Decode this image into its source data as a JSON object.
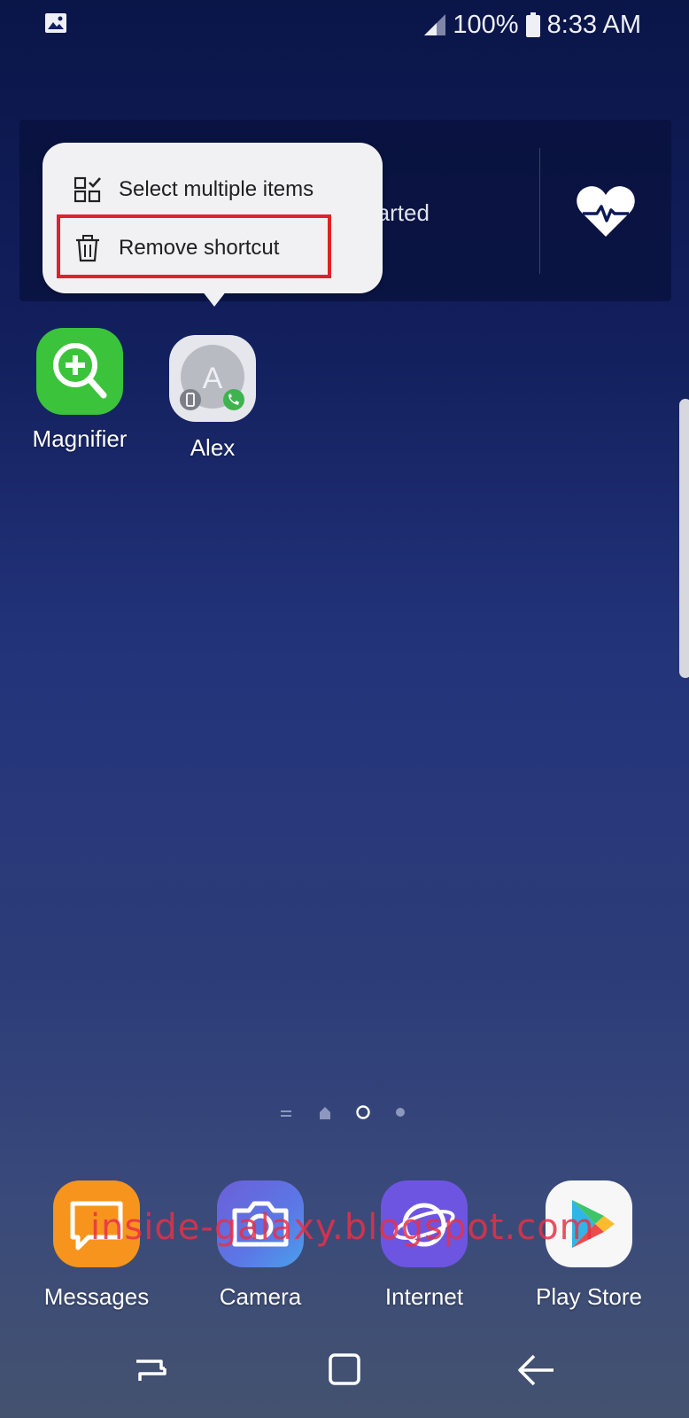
{
  "status_bar": {
    "battery": "100%",
    "time": "8:33 AM",
    "icons": [
      "gallery-icon",
      "signal-icon",
      "battery-icon"
    ]
  },
  "widget": {
    "text": "Tap to get started",
    "icon": "heart-rate-icon"
  },
  "context_menu": {
    "items": [
      {
        "label": "Select multiple items",
        "icon": "select-multiple-icon"
      },
      {
        "label": "Remove shortcut",
        "icon": "trash-icon"
      }
    ]
  },
  "home_apps": [
    {
      "label": "Magnifier",
      "icon": "magnifier-icon"
    },
    {
      "label": "Alex",
      "icon": "contact-icon",
      "initial": "A"
    }
  ],
  "dock": [
    {
      "label": "Messages",
      "icon": "messages-icon"
    },
    {
      "label": "Camera",
      "icon": "camera-icon"
    },
    {
      "label": "Internet",
      "icon": "internet-icon"
    },
    {
      "label": "Play Store",
      "icon": "play-store-icon"
    }
  ],
  "watermark": "inside-galaxy.blogspot.com",
  "nav": [
    "recents-button",
    "home-button",
    "back-button"
  ],
  "colors": {
    "highlight": "#e0202a",
    "menu_bg": "#f1f1f3",
    "magnifier": "#3bc33c",
    "messages": "#f7941d",
    "internet": "#6d55e2"
  }
}
